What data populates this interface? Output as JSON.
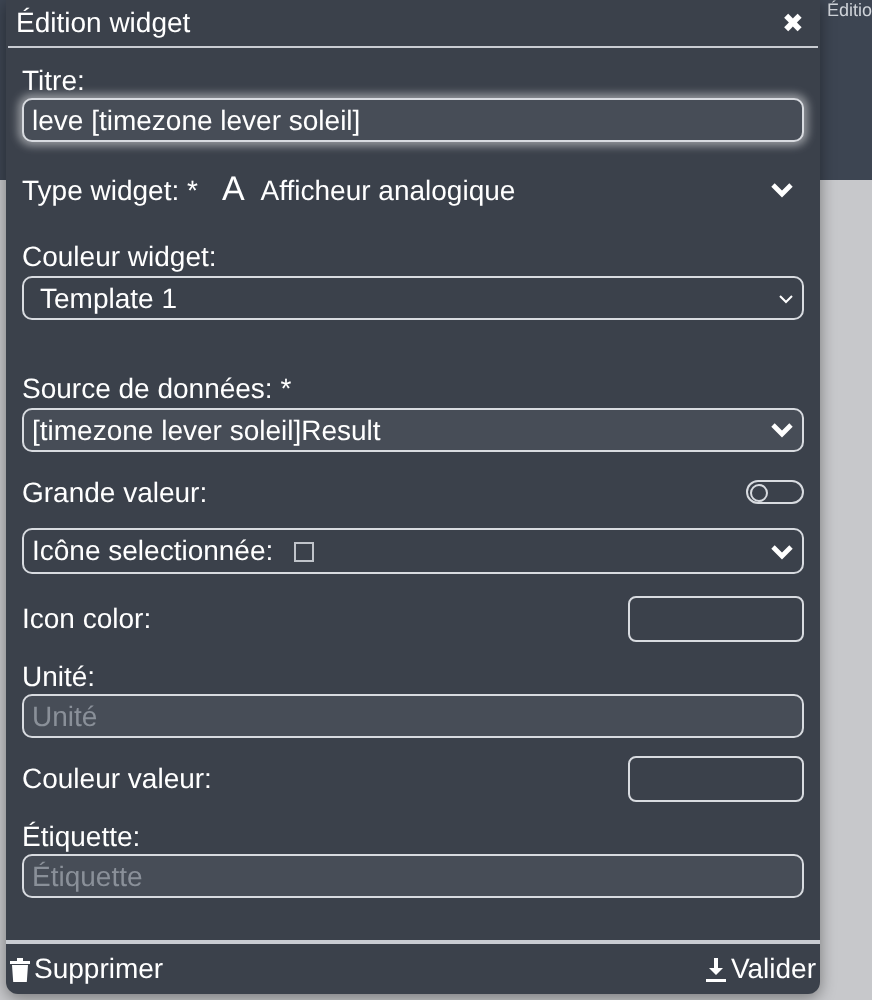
{
  "background": {
    "header_text": "Éditio"
  },
  "dialog": {
    "title": "Édition widget",
    "close": "✖"
  },
  "fields": [
    {
      "kind": "text",
      "label": "Titre:",
      "value": "leve [timezone lever soleil]",
      "focused": true
    },
    {
      "kind": "inline-select",
      "label": "Type widget: *",
      "glyph": "A",
      "value": "Afficheur analogique"
    },
    {
      "kind": "native-select",
      "label": "Couleur widget:",
      "value": "Template 1"
    },
    {
      "kind": "gap"
    },
    {
      "kind": "select",
      "label": "Source de données: *",
      "value": "[timezone lever soleil]Result"
    },
    {
      "kind": "toggle",
      "label": "Grande valeur:",
      "on": false
    },
    {
      "kind": "icon-select",
      "value": "Icône selectionnée:"
    },
    {
      "kind": "color",
      "label": "Icon color:"
    },
    {
      "kind": "text",
      "label": "Unité:",
      "placeholder": "Unité",
      "focused": false
    },
    {
      "kind": "color",
      "label": "Couleur valeur:"
    },
    {
      "kind": "text",
      "label": "Étiquette:",
      "placeholder": "Étiquette",
      "focused": false
    }
  ],
  "footer": {
    "delete": "Supprimer",
    "submit": "Valider"
  }
}
